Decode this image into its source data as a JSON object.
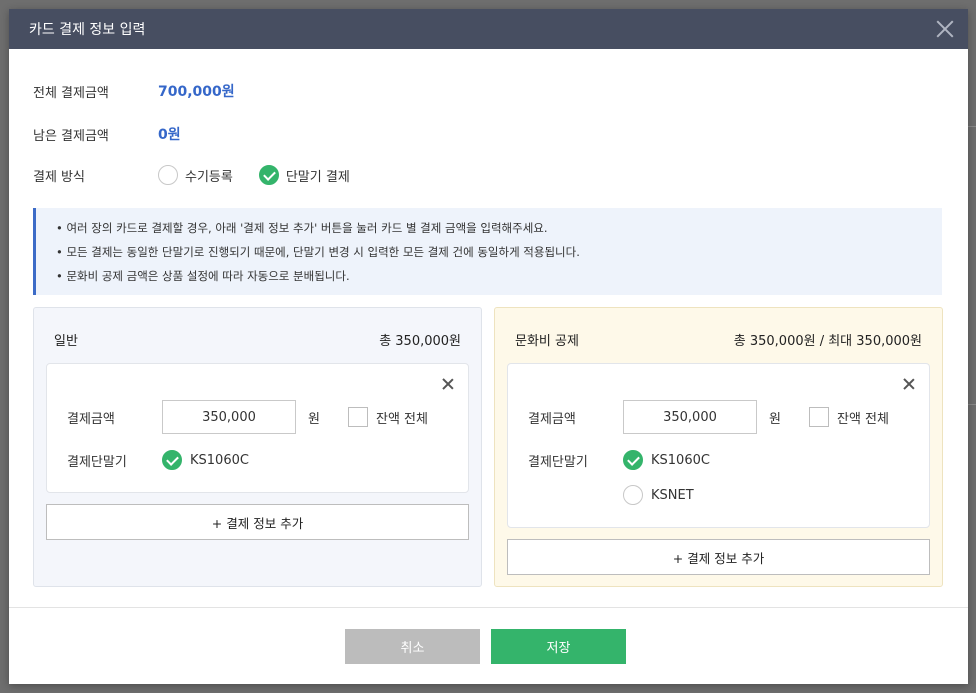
{
  "dialog": {
    "title": "카드 결제 정보 입력"
  },
  "summary": {
    "total_label": "전체 결제금액",
    "total_value": "700,000원",
    "remaining_label": "남은 결제금액",
    "remaining_value": "0원",
    "method_label": "결제 방식",
    "methods": [
      {
        "label": "수기등록",
        "selected": false
      },
      {
        "label": "단말기 결제",
        "selected": true
      }
    ]
  },
  "notice": {
    "lines": [
      "•  여러 장의 카드로 결제할 경우, 아래 '결제 정보 추가' 버튼을 눌러 카드 별 결제 금액을 입력해주세요.",
      "•  모든 결제는 동일한 단말기로 진행되기 때문에, 단말기 변경 시 입력한 모든 결제 건에 동일하게 적용됩니다.",
      "•  문화비 공제 금액은 상품 설정에 따라 자동으로 분배됩니다."
    ]
  },
  "general": {
    "title": "일반",
    "total": "총 350,000원",
    "amount_label": "결제금액",
    "amount_value": "350,000",
    "currency": "원",
    "balance_all_label": "잔액 전체",
    "terminal_label": "결제단말기",
    "terminals": [
      {
        "label": "KS1060C",
        "selected": true
      }
    ],
    "add_label": "+ 결제 정보 추가"
  },
  "culture": {
    "title": "문화비 공제",
    "total": "총 350,000원 / 최대 350,000원",
    "amount_label": "결제금액",
    "amount_value": "350,000",
    "currency": "원",
    "balance_all_label": "잔액 전체",
    "terminal_label": "결제단말기",
    "terminals": [
      {
        "label": "KS1060C",
        "selected": true
      },
      {
        "label": "KSNET",
        "selected": false
      }
    ],
    "add_label": "+ 결제 정보 추가"
  },
  "footer": {
    "cancel_label": "취소",
    "save_label": "저장"
  },
  "colors": {
    "header": "#474e61",
    "accent_blue": "#3567c9",
    "accent_green": "#34b46b"
  }
}
